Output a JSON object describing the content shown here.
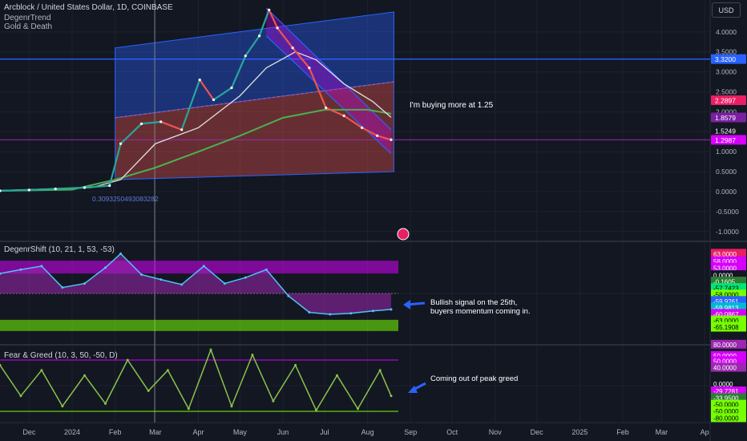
{
  "header": {
    "symbol_title": "Arcblock / United States Dollar, 1D, COINBASE",
    "indicator_1": "DegenrTrend",
    "indicator_2": "Gold & Death",
    "currency": "USD"
  },
  "pane_titles": {
    "degenshift": "DegenrShift (10, 21, 1, 53, -53)",
    "fear_greed": "Fear & Greed (10, 3, 50, -50, D)"
  },
  "annotations": {
    "buying": "I'm buying more at 1.25",
    "bullish_line1": "Bullish signal on the 25th,",
    "bullish_line2": "buyers momentum coming in.",
    "greed": "Coming out of peak greed",
    "fib_value": "0.3093250493083282"
  },
  "colors": {
    "background": "#131722",
    "price_green": "#26a69a",
    "price_red": "#ef5350",
    "channel_blue": "#2962ff",
    "ma_green": "#4caf50",
    "ma_white": "#e0e0e0",
    "magenta": "#d500f9",
    "lime": "#76ff03"
  },
  "chart_data": [
    {
      "type": "line",
      "name": "price",
      "x": [
        "2023-11-10",
        "2023-12-01",
        "2023-12-20",
        "2024-01-10",
        "2024-01-28",
        "2024-02-05",
        "2024-02-20",
        "2024-03-05",
        "2024-03-20",
        "2024-04-02",
        "2024-04-12",
        "2024-04-25",
        "2024-05-05",
        "2024-05-15",
        "2024-05-22",
        "2024-05-28",
        "2024-06-08",
        "2024-06-20",
        "2024-07-02",
        "2024-07-15",
        "2024-07-28",
        "2024-08-08",
        "2024-08-18"
      ],
      "values": [
        0.02,
        0.04,
        0.07,
        0.1,
        0.15,
        1.2,
        1.7,
        1.75,
        1.55,
        2.8,
        2.3,
        2.6,
        3.4,
        3.9,
        4.55,
        4.1,
        3.6,
        3.1,
        2.1,
        1.9,
        1.6,
        1.4,
        1.3
      ],
      "y_ticks": [
        "4.0000",
        "3.5000",
        "3.0000",
        "2.5000",
        "2.0000",
        "1.5000",
        "1.0000",
        "0.5000",
        "0.0000",
        "-0.5000",
        "-1.0000"
      ],
      "price_labels": [
        {
          "value": "3.3200",
          "color": "#2962ff"
        },
        {
          "value": "2.2897",
          "color": "#e91e63"
        },
        {
          "value": "1.8579",
          "color": "#7b1fa2"
        },
        {
          "value": "1.5249",
          "color": "#131722"
        },
        {
          "value": "1.2987",
          "color": "#d500f9"
        }
      ],
      "x_ticks": [
        "Dec",
        "2024",
        "Feb",
        "Mar",
        "Apr",
        "May",
        "Jun",
        "Jul",
        "Aug",
        "Sep",
        "Oct",
        "Nov",
        "Dec",
        "2025",
        "Feb",
        "Mar",
        "Ap"
      ]
    },
    {
      "type": "line",
      "name": "DegenrShift",
      "x": [
        "2023-11-10",
        "2023-11-25",
        "2023-12-10",
        "2023-12-25",
        "2024-01-10",
        "2024-01-25",
        "2024-02-05",
        "2024-02-20",
        "2024-03-05",
        "2024-03-20",
        "2024-04-05",
        "2024-04-20",
        "2024-05-05",
        "2024-05-20",
        "2024-06-05",
        "2024-06-20",
        "2024-07-05",
        "2024-07-20",
        "2024-08-05",
        "2024-08-18"
      ],
      "values": [
        40,
        48,
        55,
        12,
        20,
        52,
        80,
        38,
        28,
        18,
        55,
        20,
        32,
        48,
        -5,
        -38,
        -42,
        -40,
        -35,
        -32
      ],
      "y_ticks": [
        "63.0000",
        "58.0000",
        "53.0000",
        "0.0000",
        "-0.1605",
        "-57.7423",
        "-58.0000",
        "-59.9261",
        "-59.9813",
        "-60.0867",
        "-63.0000",
        "-65.1908"
      ]
    },
    {
      "type": "line",
      "name": "Fear & Greed",
      "x": [
        "2023-11-10",
        "2023-11-25",
        "2023-12-10",
        "2023-12-25",
        "2024-01-10",
        "2024-01-25",
        "2024-02-10",
        "2024-02-25",
        "2024-03-10",
        "2024-03-25",
        "2024-04-10",
        "2024-04-25",
        "2024-05-10",
        "2024-05-25",
        "2024-06-10",
        "2024-06-25",
        "2024-07-10",
        "2024-07-25",
        "2024-08-10",
        "2024-08-18"
      ],
      "values": [
        40,
        -20,
        30,
        -40,
        20,
        -35,
        50,
        -10,
        30,
        -45,
        70,
        -40,
        60,
        -30,
        40,
        -48,
        20,
        -45,
        30,
        -20
      ],
      "y_ticks": [
        "80.0000",
        "50.0000",
        "50.0000",
        "40.0000",
        "0.0000",
        "-29.7281",
        "-33.9500",
        "-50.0000",
        "-50.0000",
        "-80.0000"
      ]
    }
  ]
}
